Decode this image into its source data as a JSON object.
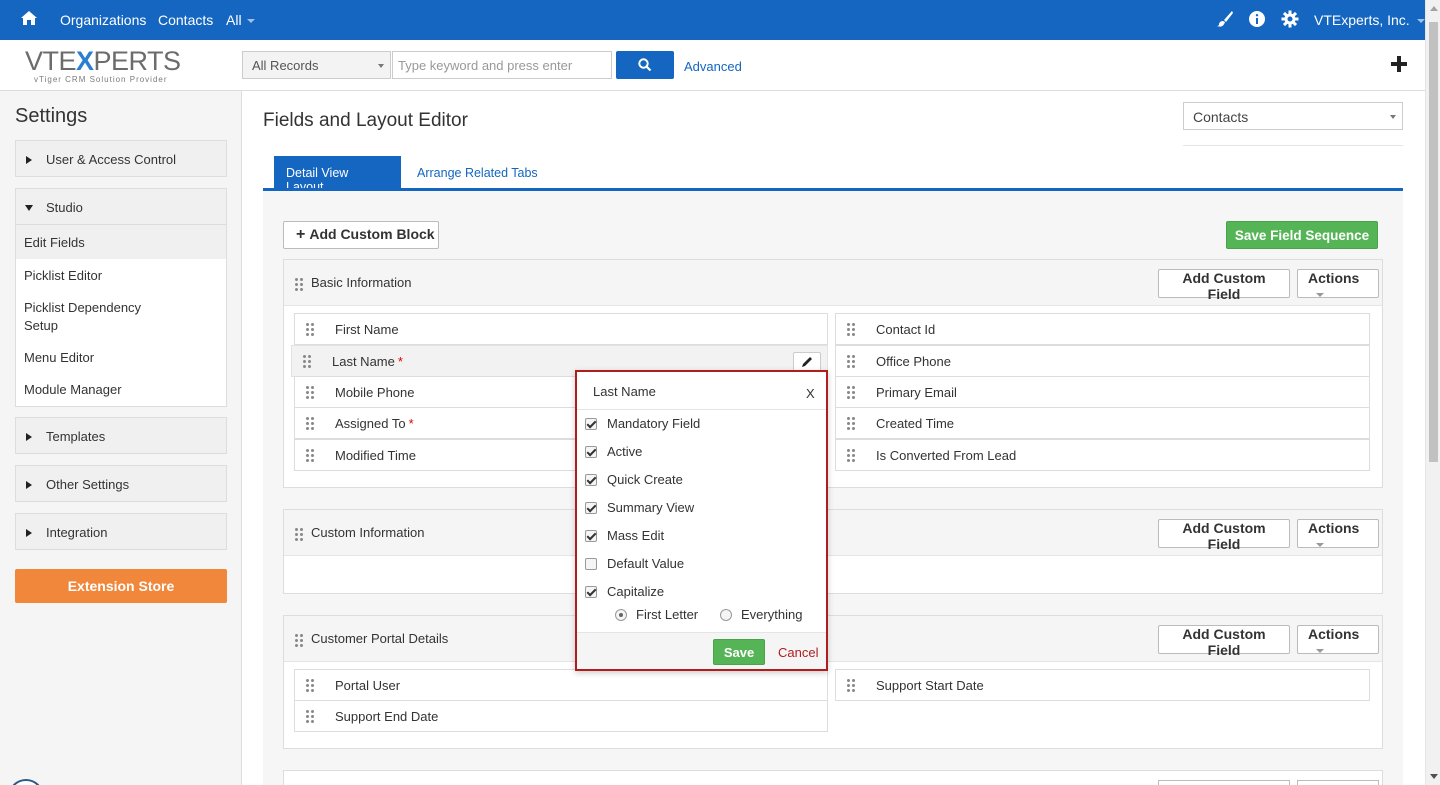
{
  "topbar": {
    "nav": [
      "Organizations",
      "Contacts",
      "All"
    ],
    "user": "VTExperts, Inc.",
    "icons": [
      "home-icon",
      "brush-icon",
      "info-icon",
      "gear-icon",
      "chevron-down-icon"
    ]
  },
  "header": {
    "logo_main": "VTE",
    "logo_x": "X",
    "logo_rest": "PERTS",
    "logo_tagline": "vTiger CRM Solution Provider",
    "records_select": "All Records",
    "search_placeholder": "Type keyword and press enter",
    "advanced": "Advanced"
  },
  "sidebar": {
    "title": "Settings",
    "sections": [
      "User & Access Control",
      "Studio",
      "Templates",
      "Other Settings",
      "Integration"
    ],
    "studio_items": [
      "Edit Fields",
      "Picklist Editor",
      "Picklist Dependency",
      "Setup",
      "Menu Editor",
      "Module Manager"
    ],
    "extension_store": "Extension Store"
  },
  "main": {
    "title": "Fields and Layout Editor",
    "module": "Contacts",
    "tabs": [
      "Detail View Layout",
      "Arrange Related Tabs"
    ],
    "add_custom_block": "Add Custom Block",
    "save_field_sequence": "Save Field Sequence",
    "add_custom_field": "Add Custom Field",
    "actions": "Actions",
    "blocks": [
      {
        "title": "Basic Information",
        "left": [
          "First Name",
          "Last Name",
          "Mobile Phone",
          "Assigned To",
          "Modified Time"
        ],
        "right": [
          "Contact Id",
          "Office Phone",
          "Primary Email",
          "Created Time",
          "Is Converted From Lead"
        ],
        "required": "*"
      },
      {
        "title": "Custom Information"
      },
      {
        "title": "Customer Portal Details",
        "left": [
          "Portal User",
          "Support End Date"
        ],
        "right": [
          "Support Start Date"
        ]
      }
    ]
  },
  "popup": {
    "title": "Last Name",
    "close": "X",
    "options": [
      {
        "label": "Mandatory Field",
        "checked": true
      },
      {
        "label": "Active",
        "checked": true
      },
      {
        "label": "Quick Create",
        "checked": true
      },
      {
        "label": "Summary View",
        "checked": true
      },
      {
        "label": "Mass Edit",
        "checked": true
      },
      {
        "label": "Default Value",
        "checked": false
      },
      {
        "label": "Capitalize",
        "checked": true
      }
    ],
    "radios": [
      {
        "label": "First Letter",
        "checked": true
      },
      {
        "label": "Everything",
        "checked": false
      }
    ],
    "save": "Save",
    "cancel": "Cancel"
  },
  "colors": {
    "brand_blue": "#1466c0",
    "save_green": "#55b556",
    "extension_orange": "#f0873a",
    "popup_border": "#b01d1d"
  }
}
